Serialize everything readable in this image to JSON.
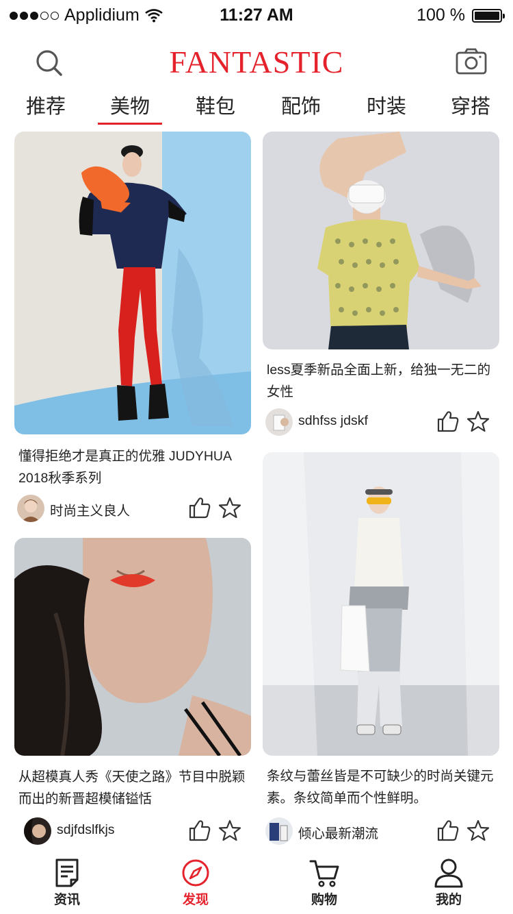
{
  "status_bar": {
    "carrier": "Applidium",
    "time": "11:27 AM",
    "battery": "100 %",
    "battery_level": 1.0,
    "signal_bars_filled": 3,
    "signal_bars_total": 5
  },
  "header": {
    "logo": "FANTASTIC",
    "search_icon": "search-icon",
    "camera_icon": "camera-icon"
  },
  "tabs": [
    {
      "label": "推荐",
      "active": false
    },
    {
      "label": "美物",
      "active": true
    },
    {
      "label": "鞋包",
      "active": false
    },
    {
      "label": "配饰",
      "active": false
    },
    {
      "label": "时装",
      "active": false
    },
    {
      "label": "穿搭",
      "active": false
    }
  ],
  "cards": [
    {
      "title": "懂得拒绝才是真正的优雅 JUDYHUA 2018秋季系列",
      "author": "时尚主义良人",
      "image": "fashion-photo-red-tights"
    },
    {
      "title": "less夏季新品全面上新，给独一无二的女性",
      "author": "sdhfss jdskf",
      "image": "fashion-photo-vr-headset"
    },
    {
      "title": "从超模真人秀《天使之路》节目中脱颖而出的新晋超模储镒恬",
      "author": "sdjfdslfkjs",
      "image": "fashion-photo-portrait-red-lips"
    },
    {
      "title": "条纹与蕾丝皆是不可缺少的时尚关键元素。条纹简单而个性鲜明。",
      "author": "倾心最新潮流",
      "image": "fashion-photo-striped-outfit"
    }
  ],
  "tabbar": [
    {
      "label": "资讯",
      "icon": "news-icon",
      "active": false
    },
    {
      "label": "发现",
      "icon": "compass-icon",
      "active": true
    },
    {
      "label": "购物",
      "icon": "cart-icon",
      "active": false
    },
    {
      "label": "我的",
      "icon": "user-icon",
      "active": false
    }
  ],
  "colors": {
    "accent": "#e5222b",
    "text": "#222222"
  }
}
